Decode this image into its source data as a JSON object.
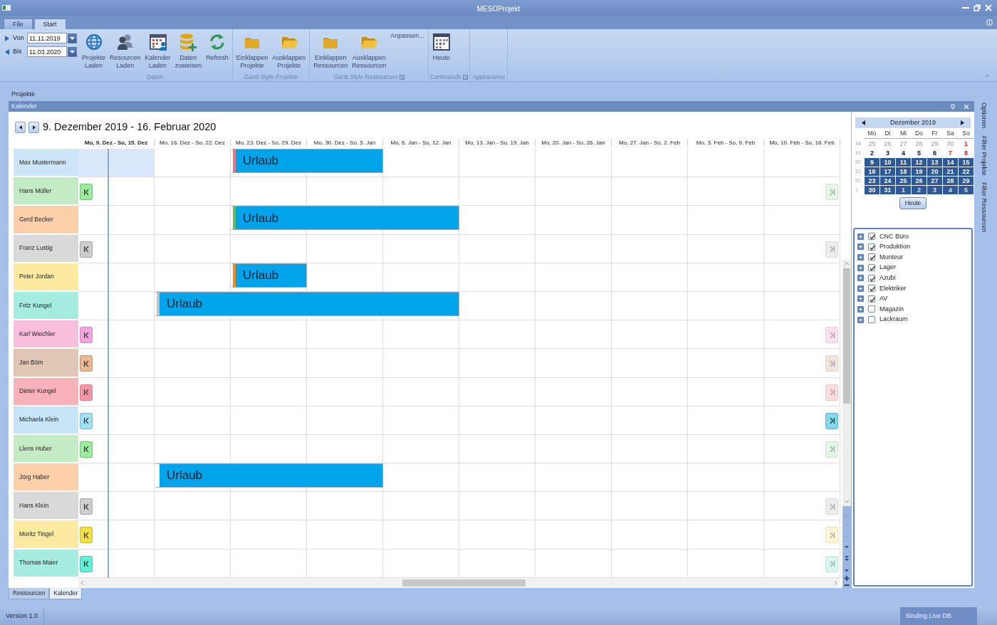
{
  "window": {
    "title": "MESOProjekt"
  },
  "ribbon_tabs": [
    {
      "label": "File",
      "selected": false
    },
    {
      "label": "Start",
      "selected": true
    }
  ],
  "date_range": [
    {
      "label": "Von",
      "value": "11.11.2019"
    },
    {
      "label": "Bis",
      "value": "11.03.2020"
    }
  ],
  "ribbon_groups": [
    {
      "label": "Daten",
      "launcher": false,
      "buttons": [
        {
          "label": "Projekte\nLaden"
        },
        {
          "label": "Resourcen\nLaden"
        },
        {
          "label": "Kalender\nLaden"
        },
        {
          "label": "Daten\nzuweisen"
        },
        {
          "label": "Refresh"
        }
      ]
    },
    {
      "label": "Gantt Style Projekte",
      "launcher": false,
      "buttons": [
        {
          "label": "Einklappen\nProjekte"
        },
        {
          "label": "Ausklappen\nProjekte"
        }
      ]
    },
    {
      "label": "Gantt Style Ressourcen",
      "launcher": true,
      "extra": "Anpassen...",
      "buttons": [
        {
          "label": "Einklappen\nRessourcen"
        },
        {
          "label": "Ausklappen\nRessourcen"
        }
      ]
    },
    {
      "label": "Commands",
      "launcher": true,
      "buttons": [
        {
          "label": "Heute"
        }
      ]
    },
    {
      "label": "Appearance",
      "launcher": false
    }
  ],
  "section_label": "Projekte",
  "calendar": {
    "panel_title": "Kalender",
    "range_title": "9. Dezember 2019 - 16. Februar 2020",
    "weeks": [
      {
        "label": "Mo, 9. Dez - So, 15. Dez",
        "selected": true
      },
      {
        "label": "Mo, 16. Dez - So, 22. Dez",
        "selected": false
      },
      {
        "label": "Mo, 23. Dez - So, 29. Dez",
        "selected": false
      },
      {
        "label": "Mo, 30. Dez - So, 5. Jan",
        "selected": false
      },
      {
        "label": "Mo, 6. Jan - So, 12. Jan",
        "selected": false
      },
      {
        "label": "Mo, 13. Jan - So, 19. Jan",
        "selected": false
      },
      {
        "label": "Mo, 20. Jan - So, 26. Jan",
        "selected": false
      },
      {
        "label": "Mo, 27. Jan - So, 2. Feb",
        "selected": false
      },
      {
        "label": "Mo, 3. Feb - So, 9. Feb",
        "selected": false
      },
      {
        "label": "Mo, 10. Feb - So, 16. Feb",
        "selected": false
      }
    ],
    "rows": [
      {
        "name": "Max Mustermann",
        "color": "#cce6f8",
        "selected": true,
        "start_arrow": false,
        "end_arrow": false,
        "bars": [
          {
            "label": "Urlaub",
            "color": "#e87a84",
            "weeks": [
              false,
              false,
              true,
              true,
              false,
              false,
              false,
              false,
              false,
              false
            ]
          }
        ]
      },
      {
        "name": "Hans Müller",
        "color": "#c4ecc4",
        "selected": false,
        "start_arrow": true,
        "end_arrow": true,
        "end_active": false
      },
      {
        "name": "Gerd Becker",
        "color": "#fdd0aa",
        "selected": false,
        "start_arrow": false,
        "end_arrow": false,
        "bars": [
          {
            "label": "Urlaub",
            "color": "#5cbf6a",
            "weeks": [
              false,
              false,
              true,
              true,
              true,
              false,
              false,
              false,
              false,
              false
            ]
          }
        ]
      },
      {
        "name": "Franz Lustig",
        "color": "#d9d9d9",
        "selected": false,
        "start_arrow": true,
        "end_arrow": true,
        "end_active": false
      },
      {
        "name": "Peter Jordan",
        "color": "#fbeaa0",
        "selected": false,
        "start_arrow": false,
        "end_arrow": false,
        "bars": [
          {
            "label": "Urlaub",
            "color": "#f08a1c",
            "weeks": [
              false,
              false,
              true,
              false,
              false,
              false,
              false,
              false,
              false,
              false
            ]
          }
        ]
      },
      {
        "name": "Fritz Kungel",
        "color": "#a6ece0",
        "selected": false,
        "start_arrow": false,
        "end_arrow": false,
        "bars": [
          {
            "label": "Urlaub",
            "color": "#c4c4c4",
            "weeks": [
              false,
              true,
              true,
              true,
              true,
              false,
              false,
              false,
              false,
              false
            ]
          }
        ]
      },
      {
        "name": "Karl Wiechler",
        "color": "#f8bedc",
        "selected": false,
        "start_arrow": true,
        "end_arrow": true,
        "end_active": false
      },
      {
        "name": "Jan Böm",
        "color": "#dfc6b4",
        "selected": false,
        "start_arrow": true,
        "end_arrow": true,
        "end_active": false
      },
      {
        "name": "Dieter Kungel",
        "color": "#f8b2ba",
        "selected": false,
        "start_arrow": true,
        "end_arrow": true,
        "end_active": false
      },
      {
        "name": "Michaela Klein",
        "color": "#c6e6f8",
        "selected": false,
        "start_arrow": true,
        "end_arrow": true,
        "end_active": true
      },
      {
        "name": "Llens Huber",
        "color": "#c4ecc4",
        "selected": false,
        "start_arrow": true,
        "end_arrow": true,
        "end_active": false
      },
      {
        "name": "Jörg Haber",
        "color": "#fdd0aa",
        "selected": false,
        "start_arrow": false,
        "end_arrow": false,
        "bars": [
          {
            "label": "Urlaub",
            "color": "#ffffff",
            "weeks": [
              false,
              true,
              true,
              true,
              false,
              false,
              false,
              false,
              false,
              false
            ]
          }
        ]
      },
      {
        "name": "Hans Klein",
        "color": "#d9d9d9",
        "selected": false,
        "start_arrow": true,
        "end_arrow": true,
        "end_active": false
      },
      {
        "name": "Moritz Tingel",
        "color": "#fbeaa0",
        "selected": false,
        "start_arrow": true,
        "end_arrow": true,
        "end_active": false
      },
      {
        "name": "Thomas Maier",
        "color": "#a6ece0",
        "selected": false,
        "start_arrow": true,
        "end_arrow": true,
        "end_active": false
      }
    ]
  },
  "mini_calendar": {
    "month": "Dezember 2019",
    "weekdays": [
      "Mo",
      "Di",
      "Mi",
      "Do",
      "Fr",
      "Sa",
      "So"
    ],
    "weeks": [
      {
        "number": "48",
        "days": [
          {
            "text": "25",
            "kind": "muted",
            "selected": false
          },
          {
            "text": "26",
            "kind": "muted",
            "selected": false
          },
          {
            "text": "27",
            "kind": "muted",
            "selected": false
          },
          {
            "text": "28",
            "kind": "muted",
            "selected": false
          },
          {
            "text": "29",
            "kind": "muted",
            "selected": false
          },
          {
            "text": "30",
            "kind": "muted",
            "selected": false
          },
          {
            "text": "1",
            "kind": "weekend",
            "selected": false
          }
        ]
      },
      {
        "number": "49",
        "days": [
          {
            "text": "2",
            "kind": "normal",
            "selected": false
          },
          {
            "text": "3",
            "kind": "normal",
            "selected": false
          },
          {
            "text": "4",
            "kind": "normal",
            "selected": false
          },
          {
            "text": "5",
            "kind": "normal",
            "selected": false
          },
          {
            "text": "6",
            "kind": "normal",
            "selected": false
          },
          {
            "text": "7",
            "kind": "weekend",
            "selected": false
          },
          {
            "text": "8",
            "kind": "weekend",
            "selected": false
          }
        ]
      },
      {
        "number": "50",
        "days": [
          {
            "text": "9",
            "kind": "normal",
            "selected": true
          },
          {
            "text": "10",
            "kind": "normal",
            "selected": true
          },
          {
            "text": "11",
            "kind": "normal",
            "selected": true
          },
          {
            "text": "12",
            "kind": "normal",
            "selected": true
          },
          {
            "text": "13",
            "kind": "normal",
            "selected": true
          },
          {
            "text": "14",
            "kind": "weekend",
            "selected": true
          },
          {
            "text": "15",
            "kind": "weekend",
            "selected": true
          }
        ]
      },
      {
        "number": "51",
        "days": [
          {
            "text": "16",
            "kind": "normal",
            "selected": true
          },
          {
            "text": "17",
            "kind": "normal",
            "selected": true
          },
          {
            "text": "18",
            "kind": "normal",
            "selected": true
          },
          {
            "text": "19",
            "kind": "normal",
            "selected": true
          },
          {
            "text": "20",
            "kind": "normal",
            "selected": true
          },
          {
            "text": "21",
            "kind": "weekend",
            "selected": true
          },
          {
            "text": "22",
            "kind": "weekend",
            "selected": true
          }
        ]
      },
      {
        "number": "52",
        "days": [
          {
            "text": "23",
            "kind": "normal",
            "selected": true
          },
          {
            "text": "24",
            "kind": "normal",
            "selected": true
          },
          {
            "text": "25",
            "kind": "normal",
            "selected": true
          },
          {
            "text": "26",
            "kind": "normal",
            "selected": true
          },
          {
            "text": "27",
            "kind": "normal",
            "selected": true
          },
          {
            "text": "28",
            "kind": "weekend",
            "selected": true
          },
          {
            "text": "29",
            "kind": "weekend",
            "selected": true
          }
        ]
      },
      {
        "number": "1",
        "days": [
          {
            "text": "30",
            "kind": "normal",
            "selected": true
          },
          {
            "text": "31",
            "kind": "normal",
            "selected": true
          },
          {
            "text": "1",
            "kind": "muted",
            "selected": true
          },
          {
            "text": "2",
            "kind": "muted",
            "selected": true
          },
          {
            "text": "3",
            "kind": "muted",
            "selected": true
          },
          {
            "text": "4",
            "kind": "muted",
            "selected": true
          },
          {
            "text": "5",
            "kind": "muted",
            "selected": true
          }
        ]
      }
    ],
    "today_button": "Heute"
  },
  "filters": [
    {
      "label": "CNC Büro",
      "checked": true
    },
    {
      "label": "Produktion",
      "checked": true
    },
    {
      "label": "Monteur",
      "checked": true
    },
    {
      "label": "Lager",
      "checked": true
    },
    {
      "label": "Azubi",
      "checked": true
    },
    {
      "label": "Elektriker",
      "checked": true
    },
    {
      "label": "AV",
      "checked": true
    },
    {
      "label": "Magazin",
      "checked": false
    },
    {
      "label": "Lackraum",
      "checked": false
    }
  ],
  "side_tabs": [
    "Optionen",
    "Filter Projekte",
    "Filter Ressourcen"
  ],
  "bottom_tabs": [
    {
      "label": "Ressourcen",
      "selected": false
    },
    {
      "label": "Kalender",
      "selected": true
    }
  ],
  "status_bar": {
    "left": "Version 1.0",
    "right": "Binding Live DB"
  }
}
